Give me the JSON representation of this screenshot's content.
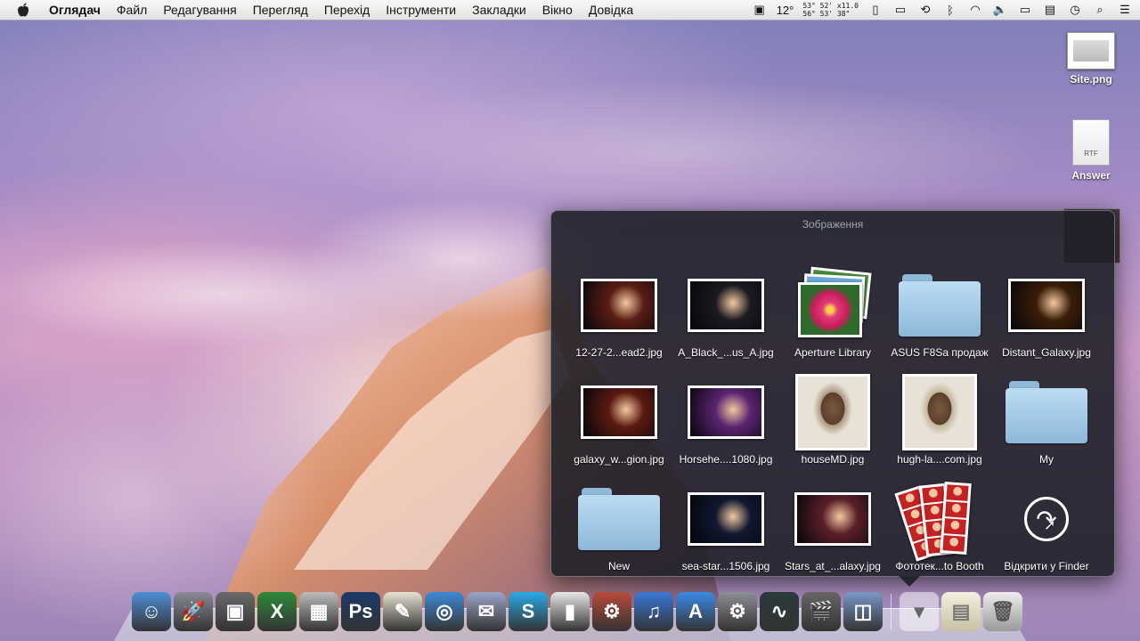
{
  "menubar": {
    "app_name": "Оглядач",
    "items": [
      "Файл",
      "Редагування",
      "Перегляд",
      "Перехід",
      "Інструменти",
      "Закладки",
      "Вікно",
      "Довідка"
    ],
    "temperature": "12°",
    "coords_line1": "53° 52' x11.0",
    "coords_line2": "56° 53' 38\""
  },
  "desktop": {
    "icons": [
      {
        "label": "Site.png"
      },
      {
        "label": "Answer",
        "doc_type": "RTF"
      }
    ]
  },
  "stack": {
    "title": "Зображення",
    "items": [
      {
        "name": "12-27-2...ead2.jpg",
        "kind": "photo",
        "color": "#5a1d14"
      },
      {
        "name": "A_Black_...us_A.jpg",
        "kind": "photo",
        "color": "#1a1a22"
      },
      {
        "name": "Aperture Library",
        "kind": "aperture"
      },
      {
        "name": "ASUS F8Sa продаж",
        "kind": "folder"
      },
      {
        "name": "Distant_Galaxy.jpg",
        "kind": "photo",
        "color": "#3a1d08"
      },
      {
        "name": "galaxy_w...gion.jpg",
        "kind": "photo",
        "color": "#5b1a10"
      },
      {
        "name": "Horsehe....1080.jpg",
        "kind": "photo",
        "color": "#5a2470"
      },
      {
        "name": "houseMD.jpg",
        "kind": "portrait",
        "color": "#a99880"
      },
      {
        "name": "hugh-la....com.jpg",
        "kind": "portrait",
        "color": "#c2b49a"
      },
      {
        "name": "My",
        "kind": "folder"
      },
      {
        "name": "New",
        "kind": "folder"
      },
      {
        "name": "sea-star...1506.jpg",
        "kind": "photo",
        "color": "#101830"
      },
      {
        "name": "Stars_at_...alaxy.jpg",
        "kind": "photo",
        "color": "#5a1f28"
      },
      {
        "name": "Фототек...to Booth",
        "kind": "booth"
      },
      {
        "name": "Відкрити у Finder",
        "kind": "finder"
      }
    ]
  },
  "dock": {
    "apps": [
      {
        "id": "finder",
        "glyph": "☺",
        "color": "#4d8fd8"
      },
      {
        "id": "launchpad",
        "glyph": "🚀",
        "color": "#8a8a96"
      },
      {
        "id": "photo-booth",
        "glyph": "▣",
        "color": "#6a6a6a"
      },
      {
        "id": "excel",
        "glyph": "X",
        "color": "#2d8a3a"
      },
      {
        "id": "calculator",
        "glyph": "▦",
        "color": "#bcbcbc"
      },
      {
        "id": "photoshop",
        "glyph": "Ps",
        "color": "#1b3a6a"
      },
      {
        "id": "textedit",
        "glyph": "✎",
        "color": "#e6e2d2"
      },
      {
        "id": "safari",
        "glyph": "◎",
        "color": "#3e8ad8"
      },
      {
        "id": "mail",
        "glyph": "✉",
        "color": "#9aa6c8"
      },
      {
        "id": "skype",
        "glyph": "S",
        "color": "#2aa9e8"
      },
      {
        "id": "mouse",
        "glyph": "▮",
        "color": "#e6e6e6"
      },
      {
        "id": "script",
        "glyph": "⚙",
        "color": "#b84a3a"
      },
      {
        "id": "itunes",
        "glyph": "♫",
        "color": "#3a78d8"
      },
      {
        "id": "app-store",
        "glyph": "A",
        "color": "#3a8ae8"
      },
      {
        "id": "system-preferences",
        "glyph": "⚙",
        "color": "#8e8e96"
      },
      {
        "id": "activity-monitor",
        "glyph": "∿",
        "color": "#2a3a3a"
      },
      {
        "id": "imovie",
        "glyph": "🎬",
        "color": "#666"
      },
      {
        "id": "preview",
        "glyph": "◫",
        "color": "#7a98c8"
      }
    ]
  }
}
